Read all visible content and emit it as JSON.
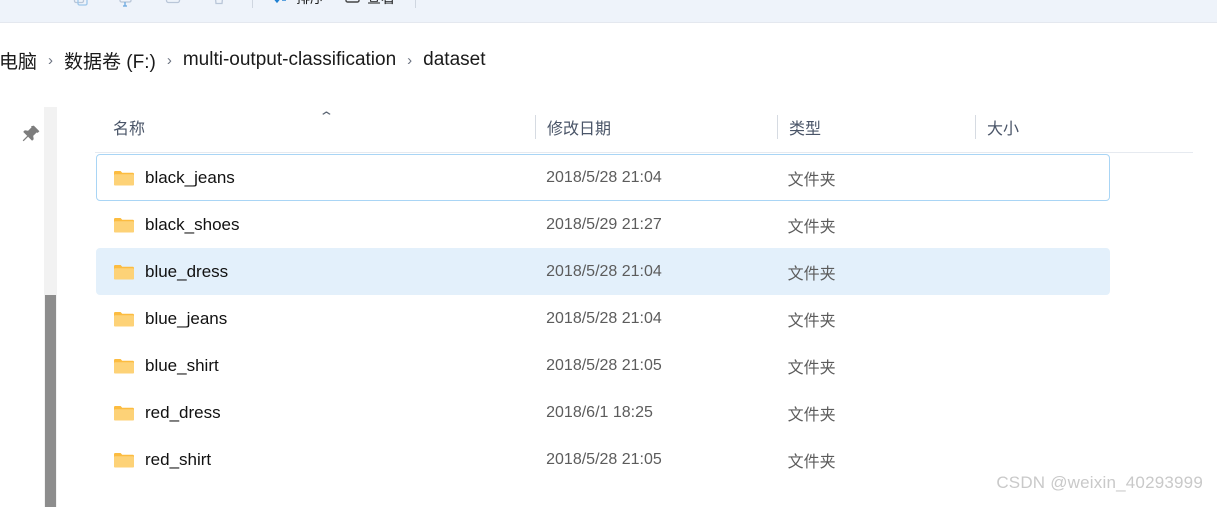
{
  "toolbar": {
    "buttons": [
      {
        "name": "copy-button",
        "icon": "copy-icon",
        "label": ""
      },
      {
        "name": "paste-button",
        "icon": "paste-icon",
        "label": ""
      },
      {
        "name": "rename-button",
        "icon": "rename-icon",
        "label": ""
      },
      {
        "name": "delete-button",
        "icon": "trash-icon",
        "label": ""
      }
    ],
    "sort_label": "排序",
    "view_label": "查看"
  },
  "breadcrumb": {
    "separator": "›",
    "items": [
      {
        "label": "电脑"
      },
      {
        "label": "数据卷 (F:)"
      },
      {
        "label": "multi-output-classification"
      },
      {
        "label": "dataset"
      }
    ]
  },
  "sidebar": {
    "pin_icon": "pin-icon"
  },
  "filelist": {
    "columns": [
      {
        "key": "name",
        "label": "名称",
        "sorted": "asc",
        "sort_glyph": "⌃"
      },
      {
        "key": "date",
        "label": "修改日期"
      },
      {
        "key": "type",
        "label": "类型"
      },
      {
        "key": "size",
        "label": "大小"
      }
    ],
    "rows": [
      {
        "name": "black_jeans",
        "date": "2018/5/28 21:04",
        "type": "文件夹",
        "size": "",
        "icon": "folder-icon",
        "state": "focused"
      },
      {
        "name": "black_shoes",
        "date": "2018/5/29 21:27",
        "type": "文件夹",
        "size": "",
        "icon": "folder-icon",
        "state": "normal"
      },
      {
        "name": "blue_dress",
        "date": "2018/5/28 21:04",
        "type": "文件夹",
        "size": "",
        "icon": "folder-icon",
        "state": "selected"
      },
      {
        "name": "blue_jeans",
        "date": "2018/5/28 21:04",
        "type": "文件夹",
        "size": "",
        "icon": "folder-icon",
        "state": "normal"
      },
      {
        "name": "blue_shirt",
        "date": "2018/5/28 21:05",
        "type": "文件夹",
        "size": "",
        "icon": "folder-icon",
        "state": "normal"
      },
      {
        "name": "red_dress",
        "date": "2018/6/1 18:25",
        "type": "文件夹",
        "size": "",
        "icon": "folder-icon",
        "state": "normal"
      },
      {
        "name": "red_shirt",
        "date": "2018/5/28 21:05",
        "type": "文件夹",
        "size": "",
        "icon": "folder-icon",
        "state": "normal"
      }
    ]
  },
  "watermark": {
    "text": "CSDN @weixin_40293999"
  },
  "colors": {
    "toolbar_bg": "#eef3fa",
    "selection_bg": "#e3f0fb",
    "focus_border": "#a9d5f5",
    "folder_icon": "#ffc societies"
  }
}
